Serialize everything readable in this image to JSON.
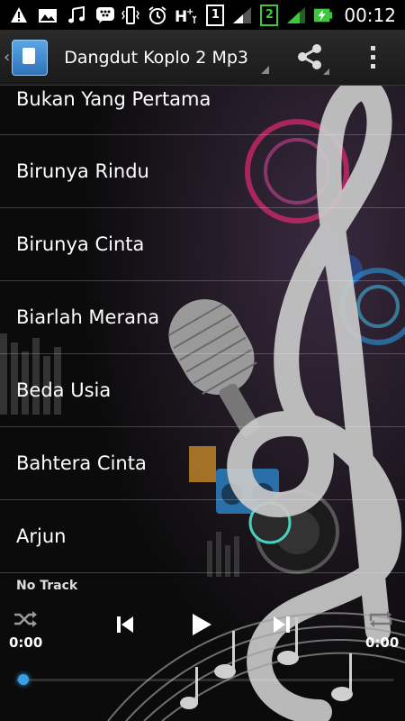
{
  "status_bar": {
    "time": "00:12",
    "sim_slots": [
      "1",
      "2"
    ],
    "icons": [
      "alert-icon",
      "image-icon",
      "music-icon",
      "bbm-icon",
      "vibrate-icon",
      "alarm-icon",
      "hspa-icon",
      "signal-icon",
      "battery-charging-icon"
    ]
  },
  "action_bar": {
    "title": "Dangdut Koplo 2 Mp3",
    "icons": [
      "app-icon",
      "share-icon",
      "overflow-menu-icon"
    ]
  },
  "tracks": [
    "Bukan Yang Pertama",
    "Birunya Rindu",
    "Birunya Cinta",
    "Biarlah Merana",
    "Beda Usia",
    "Bahtera Cinta",
    "Arjun"
  ],
  "player": {
    "now_playing": "No Track",
    "elapsed": "0:00",
    "duration": "0:00",
    "progress": 0,
    "icons": [
      "shuffle-icon",
      "previous-icon",
      "play-icon",
      "next-icon",
      "repeat-icon"
    ]
  },
  "colors": {
    "accent": "#3aa0e6",
    "background": "#0b0b0b",
    "bar": "#1e1e1e"
  }
}
